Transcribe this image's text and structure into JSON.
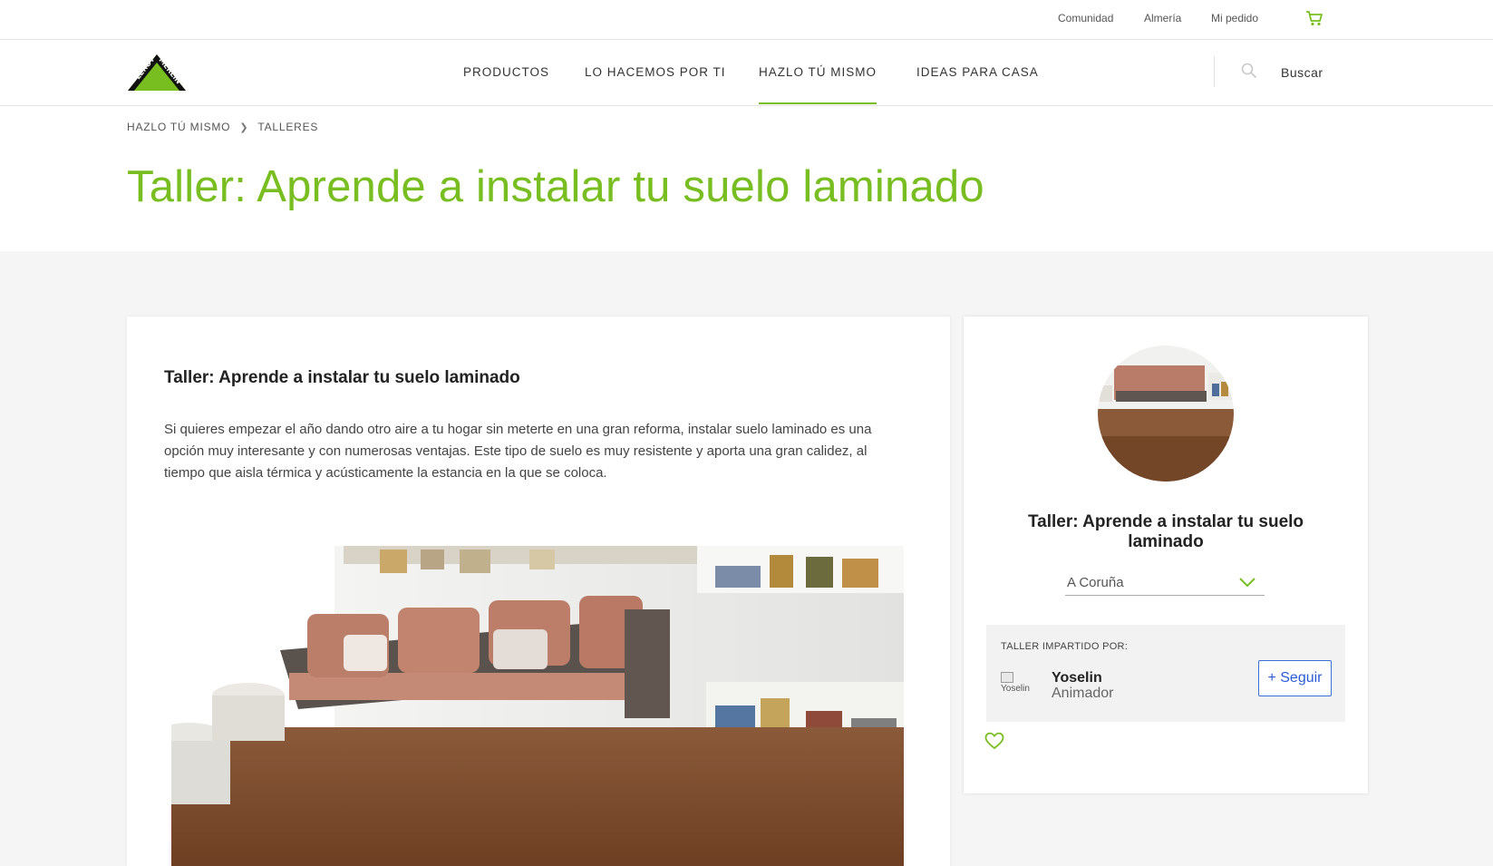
{
  "topbar": {
    "links": [
      "Comunidad",
      "Almería",
      "Mi pedido"
    ],
    "cart_icon": "cart-icon"
  },
  "nav": {
    "logo_alt": "LEROY MERLIN",
    "items": [
      "PRODUCTOS",
      "LO HACEMOS POR TI",
      "HAZLO TÚ MISMO",
      "IDEAS PARA CASA"
    ],
    "active": "HAZLO TÚ MISMO",
    "search_label": "Buscar"
  },
  "breadcrumb": [
    "HAZLO TÚ MISMO",
    "TALLERES"
  ],
  "page_title": "Taller: Aprende a instalar tu suelo laminado",
  "article": {
    "title": "Taller: Aprende a instalar tu suelo laminado",
    "body": "Si quieres empezar el año dando otro aire a tu hogar sin meterte en una gran reforma, instalar suelo laminado es una opción muy interesante y con numerosas ventajas. Este tipo de suelo es muy resistente y aporta una gran calidez, al tiempo que aisla térmica y acústicamente la estancia en la que se coloca."
  },
  "sidebar": {
    "title": "Taller: Aprende a instalar tu suelo laminado",
    "location": "A Coruña",
    "instructor_label": "TALLER IMPARTIDO POR:",
    "instructor_img_alt": "Yoselin",
    "instructor_name": "Yoselin",
    "instructor_role": "Animador",
    "follow_label": "+ Seguir"
  },
  "colors": {
    "brand_green": "#78be20",
    "follow_blue": "#2a5bd7",
    "background_grey": "#f5f5f5"
  }
}
